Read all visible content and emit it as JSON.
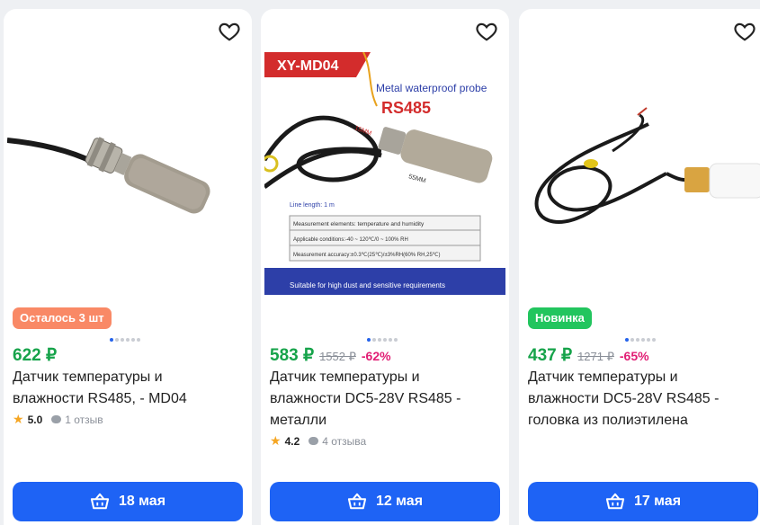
{
  "products": [
    {
      "badge": "Осталось 3 шт",
      "price": "622 ₽",
      "old_price": "",
      "discount": "",
      "title": "Датчик температуры и влажности RS485, - MD04",
      "rating": "5.0",
      "reviews": "1 отзыв",
      "delivery": "18 мая"
    },
    {
      "badge": "",
      "price": "583 ₽",
      "old_price": "1552 ₽",
      "discount": "-62%",
      "title": "Датчик температуры и влажности DC5-28V RS485 - металли",
      "rating": "4.2",
      "reviews": "4 отзыва",
      "delivery": "12 мая",
      "image_text": {
        "model": "XY-MD04",
        "probe": "Metal waterproof probe",
        "protocol": "RS485",
        "dim1": "15MM",
        "dim2": "55MM",
        "line_length": "Line length: 1 m",
        "spec1": "Measurement elements: temperature and humidity",
        "spec2": "Applicable conditions:-40 ~ 120℃/0 ~ 100% RH",
        "spec3": "Measurement accuracy:±0.3℃(25℃)/±3%RH(60% RH,25℃)",
        "footer": "Suitable for high dust and sensitive requirements"
      }
    },
    {
      "badge": "Новинка",
      "price": "437 ₽",
      "old_price": "1271 ₽",
      "discount": "-65%",
      "title": "Датчик температуры и влажности DC5-28V RS485 - головка из полиэтилена",
      "rating": "",
      "reviews": "",
      "delivery": "17 мая"
    }
  ],
  "colors": {
    "price": "#16a34a",
    "discount": "#e11d74",
    "button": "#1e63f5",
    "badge_orange": "#f98966",
    "badge_green": "#22c55e"
  },
  "icons": [
    "heart-icon",
    "basket-icon",
    "star-icon",
    "comment-icon"
  ]
}
